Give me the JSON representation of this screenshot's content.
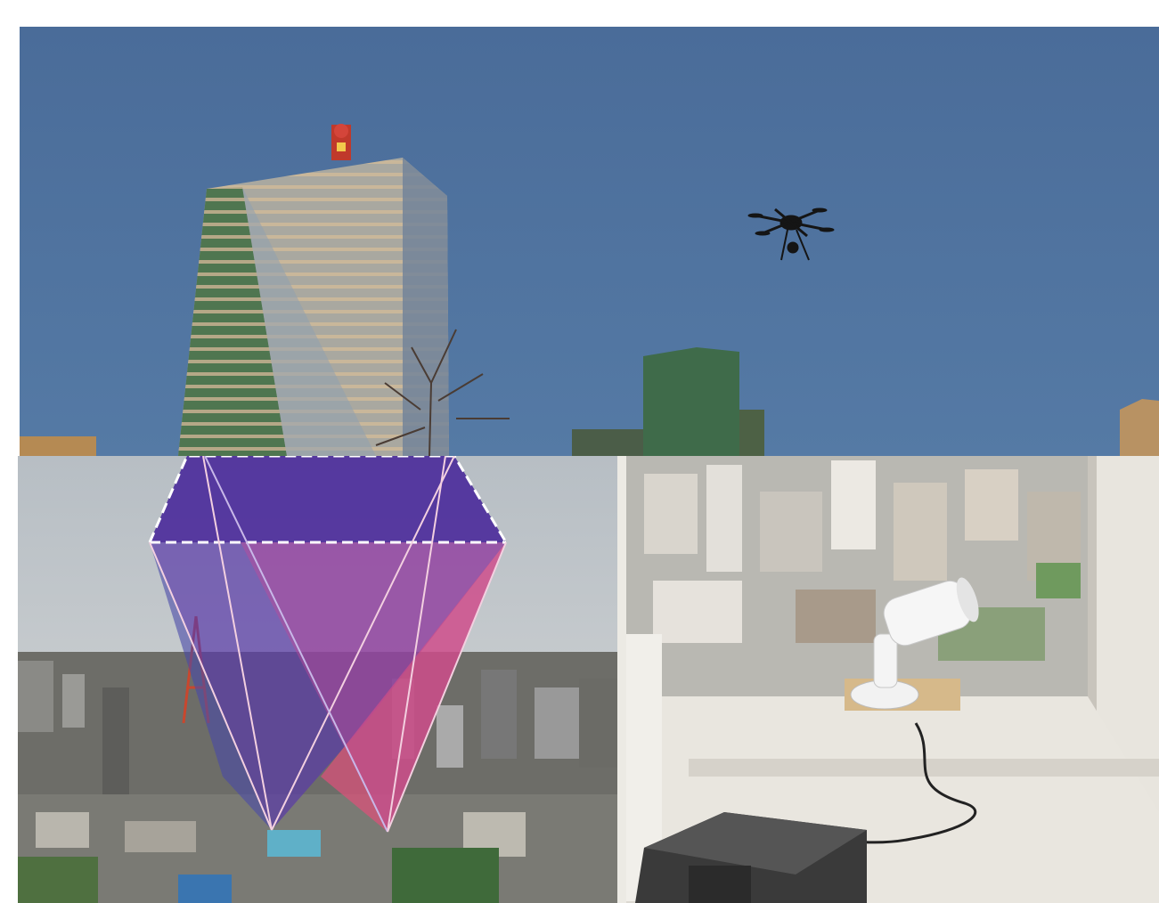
{
  "figure": {
    "panels": [
      {
        "id": "top",
        "subject": "drone-over-city-skyline"
      },
      {
        "id": "bottom-left",
        "subject": "camera-field-of-view-pyramids-over-city"
      },
      {
        "id": "bottom-right",
        "subject": "security-camera-on-window-sill"
      }
    ]
  },
  "colors": {
    "sky": "#4f6f98",
    "fov_purple": "#4a2a9a",
    "fov_pink": "#e0507a",
    "fov_blue": "#4a4aa8",
    "sill": "#e9e6df"
  }
}
